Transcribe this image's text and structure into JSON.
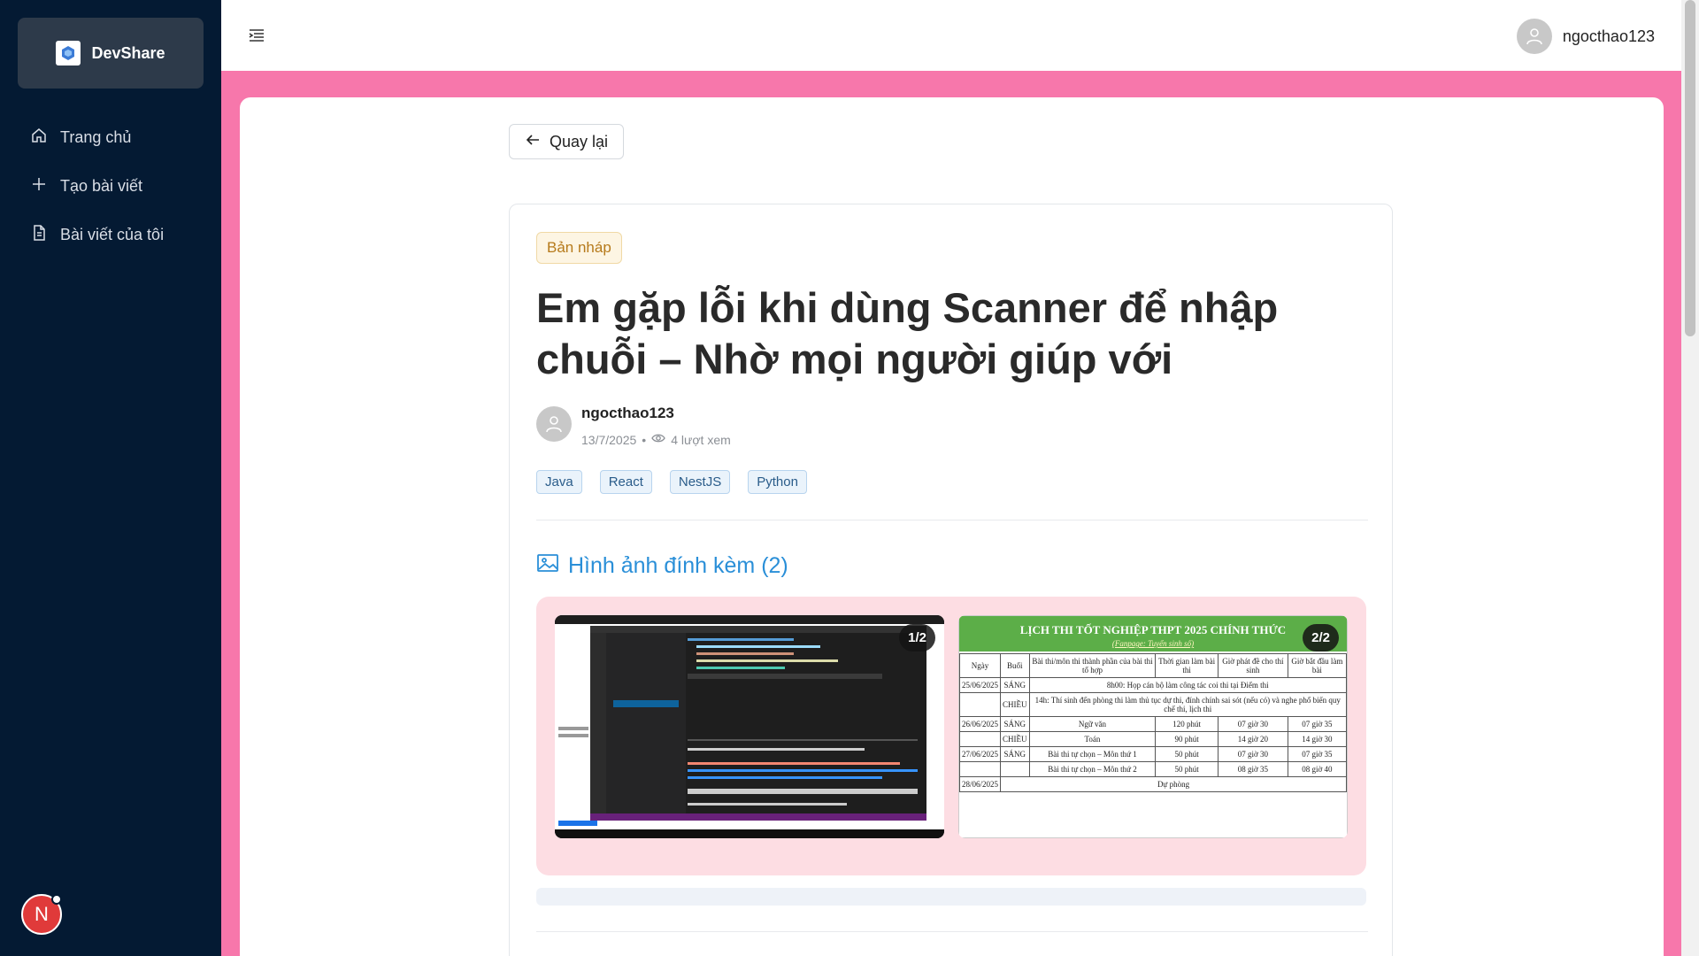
{
  "brand": {
    "name": "DevShare"
  },
  "nav": {
    "items": [
      {
        "label": "Trang chủ",
        "icon": "home-icon"
      },
      {
        "label": "Tạo bài viết",
        "icon": "plus-icon"
      },
      {
        "label": "Bài viết của tôi",
        "icon": "document-icon"
      }
    ]
  },
  "header": {
    "username": "ngocthao123"
  },
  "user_badge": {
    "initial": "N"
  },
  "back_button": {
    "label": "Quay lại"
  },
  "post": {
    "status": "Bản nháp",
    "title": "Em gặp lỗi khi dùng Scanner để nhập chuỗi – Nhờ mọi người giúp với",
    "author": "ngocthao123",
    "date": "13/7/2025",
    "views": "4 lượt xem",
    "tags": [
      "Java",
      "React",
      "NestJS",
      "Python"
    ]
  },
  "attachments": {
    "heading": "Hình ảnh đính kèm (2)",
    "images": [
      {
        "counter": "1/2"
      },
      {
        "counter": "2/2"
      }
    ]
  },
  "schedule": {
    "title": "LỊCH THI TỐT NGHIỆP THPT 2025 CHÍNH THỨC",
    "subtitle": "(Fanpage: Tuyển sinh số)",
    "headers": [
      "Ngày",
      "Buổi",
      "Bài thi/môn thi thành phần của bài thi tổ hợp",
      "Thời gian làm bài thi",
      "Giờ phát đề cho thí sinh",
      "Giờ bắt đầu làm bài"
    ],
    "rows": [
      [
        "25/06/2025",
        "SÁNG",
        "8h00: Họp cán bộ làm công tác coi thi tại Điểm thi",
        "",
        "",
        ""
      ],
      [
        "",
        "CHIỀU",
        "14h: Thí sinh đến phòng thi làm thủ tục dự thi, đính chính sai sót (nếu có) và nghe phổ biến quy chế thi, lịch thi",
        "",
        "",
        ""
      ],
      [
        "26/06/2025",
        "SÁNG",
        "Ngữ văn",
        "120 phút",
        "07 giờ 30",
        "07 giờ 35"
      ],
      [
        "",
        "CHIỀU",
        "Toán",
        "90 phút",
        "14 giờ 20",
        "14 giờ 30"
      ],
      [
        "27/06/2025",
        "SÁNG",
        "Bài thi tự chọn – Môn thứ 1",
        "50 phút",
        "07 giờ 30",
        "07 giờ 35"
      ],
      [
        "",
        "",
        "Bài thi tự chọn – Môn thứ 2",
        "50 phút",
        "08 giờ 35",
        "08 giờ 40"
      ],
      [
        "28/06/2025",
        "",
        "Dự phòng",
        "",
        "",
        ""
      ]
    ]
  },
  "colors": {
    "sidebar": "#041a33",
    "page_background": "#f777ab",
    "accent": "#2a8fd8",
    "draft_badge": "#b67a1b"
  }
}
